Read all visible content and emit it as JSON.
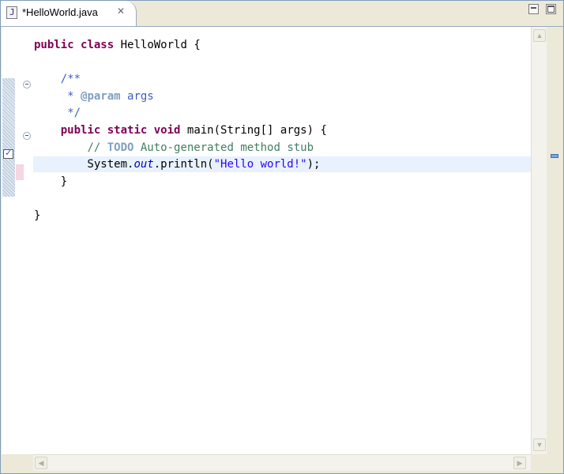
{
  "tab": {
    "title": "*HelloWorld.java",
    "icon": "java-file-icon",
    "icon_glyph": "J",
    "close_icon": "close-icon",
    "close_glyph": "✕"
  },
  "window_buttons": {
    "minimize": "minimize-icon",
    "maximize": "maximize-icon"
  },
  "editor": {
    "current_line": 8,
    "lines": [
      [
        {
          "t": "public",
          "c": "kw"
        },
        {
          "t": " "
        },
        {
          "t": "class",
          "c": "kw"
        },
        {
          "t": " HelloWorld {"
        }
      ],
      [],
      [
        {
          "t": "    "
        },
        {
          "t": "/**",
          "c": "jd"
        }
      ],
      [
        {
          "t": "     * ",
          "c": "jd"
        },
        {
          "t": "@param",
          "c": "jt"
        },
        {
          "t": " args",
          "c": "jd"
        }
      ],
      [
        {
          "t": "     */",
          "c": "jd"
        }
      ],
      [
        {
          "t": "    "
        },
        {
          "t": "public",
          "c": "kw"
        },
        {
          "t": " "
        },
        {
          "t": "static",
          "c": "kw"
        },
        {
          "t": " "
        },
        {
          "t": "void",
          "c": "kw"
        },
        {
          "t": " main(String[] args) {"
        }
      ],
      [
        {
          "t": "        "
        },
        {
          "t": "// ",
          "c": "cm"
        },
        {
          "t": "TODO",
          "c": "jt"
        },
        {
          "t": " Auto-generated method stub",
          "c": "cm"
        }
      ],
      [
        {
          "t": "        System."
        },
        {
          "t": "out",
          "c": "fld"
        },
        {
          "t": ".println("
        },
        {
          "t": "\"Hello world!\"",
          "c": "str"
        },
        {
          "t": ");"
        }
      ],
      [
        {
          "t": "    }"
        }
      ],
      [],
      [
        {
          "t": "}"
        }
      ]
    ]
  },
  "scrollbar": {
    "up_glyph": "▲",
    "down_glyph": "▼",
    "left_glyph": "◀",
    "right_glyph": "▶"
  }
}
